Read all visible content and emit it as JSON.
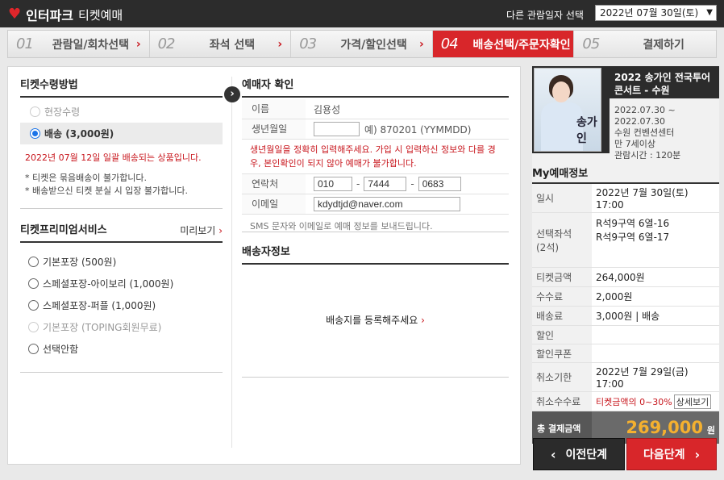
{
  "header": {
    "brand": "인터파크",
    "subtitle": "티켓예매",
    "other_date_label": "다른 관람일자 선택",
    "selected_date": "2022년 07월 30일(토)"
  },
  "steps": [
    {
      "num": "01",
      "label": "관람일/회차선택"
    },
    {
      "num": "02",
      "label": "좌석 선택"
    },
    {
      "num": "03",
      "label": "가격/할인선택"
    },
    {
      "num": "04",
      "label": "배송선택/주문자확인"
    },
    {
      "num": "05",
      "label": "결제하기"
    }
  ],
  "receive": {
    "title": "티켓수령방법",
    "options": [
      "현장수령",
      "배송 (3,000원)"
    ],
    "notice": "2022년 07월 12일 일괄 배송되는 상품입니다.",
    "notes": [
      "* 티켓은 묶음배송이 불가합니다.",
      "* 배송받으신 티켓 분실 시 입장 불가합니다."
    ]
  },
  "premium": {
    "title": "티켓프리미엄서비스",
    "preview": "미리보기",
    "options": [
      "기본포장 (500원)",
      "스페셜포장-아이보리 (1,000원)",
      "스페셜포장-퍼플 (1,000원)",
      "기본포장 (TOPING회원무료)",
      "선택안함"
    ]
  },
  "buyer": {
    "title": "예매자 확인",
    "name_label": "이름",
    "name_value": "김용성",
    "birth_label": "생년월일",
    "birth_value": "",
    "birth_hint": "예) 870201 (YYMMDD)",
    "warning": "생년월일을 정확히 입력해주세요. 가입 시 입력하신 정보와 다를 경우, 본인확인이 되지 않아 예매가 불가합니다.",
    "phone_label": "연락처",
    "phone": [
      "010",
      "7444",
      "0683"
    ],
    "phone_sep": "-",
    "email_label": "이메일",
    "email": "kdydtjd@naver.com",
    "sms_info": "SMS 문자와 이메일로 예매 정보를 보내드립니다."
  },
  "shipping": {
    "title": "배송자정보",
    "register_link": "배송지를 등록해주세요",
    "chevron": "›"
  },
  "show": {
    "title": "2022 송가인 전국투어 콘서트 - 수원",
    "poster_text": "송가인",
    "period": "2022.07.30 ~ 2022.07.30",
    "venue": "수원 컨벤션센터",
    "age": "만 7세이상",
    "runtime": "관람시간 : 120분"
  },
  "my_booking": {
    "title": "My예매정보",
    "date_label": "일시",
    "date_value": "2022년 7월 30일(토) 17:00",
    "seat_label": "선택좌석\n(2석)",
    "seats": [
      "R석9구역 6열-16",
      "R석9구역 6열-17"
    ],
    "ticket_label": "티켓금액",
    "ticket_value": "264,000원",
    "fee_label": "수수료",
    "fee_value": "2,000원",
    "delivery_label": "배송료",
    "delivery_value": "3,000원 | 배송",
    "discount_label": "할인",
    "coupon_label": "할인쿠폰",
    "cancel_deadline_label": "취소기한",
    "cancel_deadline_value": "2022년 7월 29일(금) 17:00",
    "cancel_fee_label": "취소수수료",
    "cancel_fee_value": "티켓금액의 0~30%",
    "detail_button": "상세보기",
    "total_label": "총 결제금액",
    "total_value": "269,000",
    "total_unit": "원"
  },
  "nav": {
    "prev": "이전단계",
    "next": "다음단계"
  },
  "colors": {
    "accent": "#d8262a",
    "header": "#2c2c2c",
    "total": "#f4b02f"
  }
}
